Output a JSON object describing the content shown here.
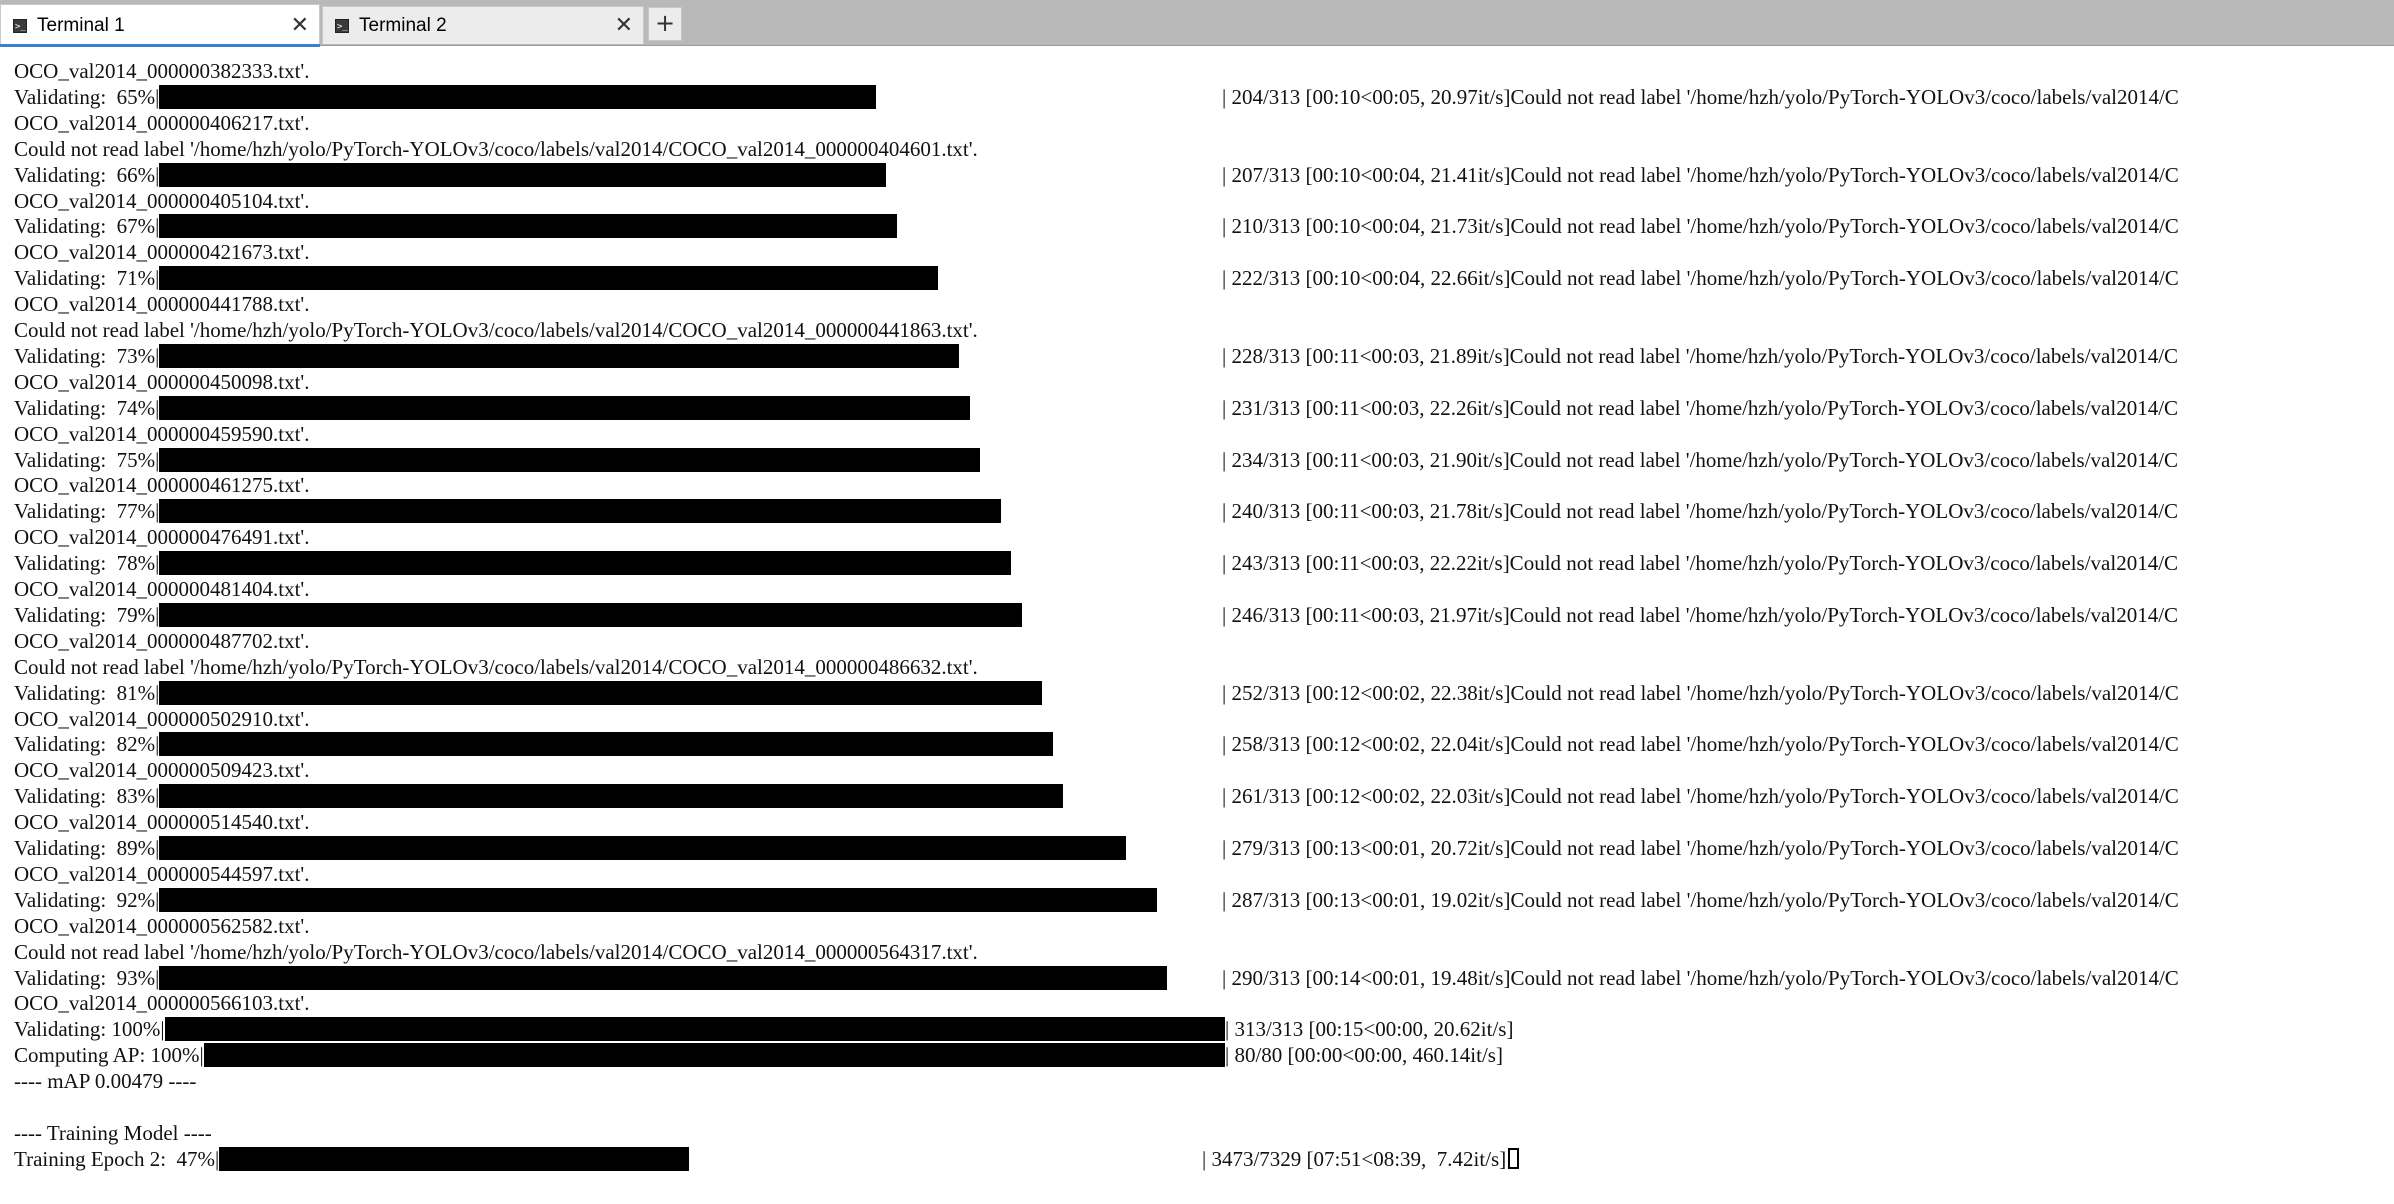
{
  "tabs": [
    {
      "label": "Terminal 1",
      "icon": "terminal-icon",
      "active": true
    },
    {
      "label": "Terminal 2",
      "icon": "terminal-icon",
      "active": false
    }
  ],
  "terminal": {
    "lines": [
      {
        "text": "OCO_val2014_000000382333.txt'."
      },
      {
        "text": "Validating:  65%|",
        "bar": 0.65,
        "stats": "| 204/313 [00:10<00:05, 20.97it/s]Could not read label '/home/hzh/yolo/PyTorch-YOLOv3/coco/labels/val2014/C"
      },
      {
        "text": "OCO_val2014_000000406217.txt'."
      },
      {
        "text": "Could not read label '/home/hzh/yolo/PyTorch-YOLOv3/coco/labels/val2014/COCO_val2014_000000404601.txt'."
      },
      {
        "text": "Validating:  66%|",
        "bar": 0.66,
        "stats": "| 207/313 [00:10<00:04, 21.41it/s]Could not read label '/home/hzh/yolo/PyTorch-YOLOv3/coco/labels/val2014/C"
      },
      {
        "text": "OCO_val2014_000000405104.txt'."
      },
      {
        "text": "Validating:  67%|",
        "bar": 0.67,
        "stats": "| 210/313 [00:10<00:04, 21.73it/s]Could not read label '/home/hzh/yolo/PyTorch-YOLOv3/coco/labels/val2014/C"
      },
      {
        "text": "OCO_val2014_000000421673.txt'."
      },
      {
        "text": "Validating:  71%|",
        "bar": 0.71,
        "stats": "| 222/313 [00:10<00:04, 22.66it/s]Could not read label '/home/hzh/yolo/PyTorch-YOLOv3/coco/labels/val2014/C"
      },
      {
        "text": "OCO_val2014_000000441788.txt'."
      },
      {
        "text": "Could not read label '/home/hzh/yolo/PyTorch-YOLOv3/coco/labels/val2014/COCO_val2014_000000441863.txt'."
      },
      {
        "text": "Validating:  73%|",
        "bar": 0.73,
        "stats": "| 228/313 [00:11<00:03, 21.89it/s]Could not read label '/home/hzh/yolo/PyTorch-YOLOv3/coco/labels/val2014/C"
      },
      {
        "text": "OCO_val2014_000000450098.txt'."
      },
      {
        "text": "Validating:  74%|",
        "bar": 0.74,
        "stats": "| 231/313 [00:11<00:03, 22.26it/s]Could not read label '/home/hzh/yolo/PyTorch-YOLOv3/coco/labels/val2014/C"
      },
      {
        "text": "OCO_val2014_000000459590.txt'."
      },
      {
        "text": "Validating:  75%|",
        "bar": 0.75,
        "stats": "| 234/313 [00:11<00:03, 21.90it/s]Could not read label '/home/hzh/yolo/PyTorch-YOLOv3/coco/labels/val2014/C"
      },
      {
        "text": "OCO_val2014_000000461275.txt'."
      },
      {
        "text": "Validating:  77%|",
        "bar": 0.77,
        "stats": "| 240/313 [00:11<00:03, 21.78it/s]Could not read label '/home/hzh/yolo/PyTorch-YOLOv3/coco/labels/val2014/C"
      },
      {
        "text": "OCO_val2014_000000476491.txt'."
      },
      {
        "text": "Validating:  78%|",
        "bar": 0.78,
        "stats": "| 243/313 [00:11<00:03, 22.22it/s]Could not read label '/home/hzh/yolo/PyTorch-YOLOv3/coco/labels/val2014/C"
      },
      {
        "text": "OCO_val2014_000000481404.txt'."
      },
      {
        "text": "Validating:  79%|",
        "bar": 0.79,
        "stats": "| 246/313 [00:11<00:03, 21.97it/s]Could not read label '/home/hzh/yolo/PyTorch-YOLOv3/coco/labels/val2014/C"
      },
      {
        "text": "OCO_val2014_000000487702.txt'."
      },
      {
        "text": "Could not read label '/home/hzh/yolo/PyTorch-YOLOv3/coco/labels/val2014/COCO_val2014_000000486632.txt'."
      },
      {
        "text": "Validating:  81%|",
        "bar": 0.81,
        "stats": "| 252/313 [00:12<00:02, 22.38it/s]Could not read label '/home/hzh/yolo/PyTorch-YOLOv3/coco/labels/val2014/C"
      },
      {
        "text": "OCO_val2014_000000502910.txt'."
      },
      {
        "text": "Validating:  82%|",
        "bar": 0.82,
        "stats": "| 258/313 [00:12<00:02, 22.04it/s]Could not read label '/home/hzh/yolo/PyTorch-YOLOv3/coco/labels/val2014/C"
      },
      {
        "text": "OCO_val2014_000000509423.txt'."
      },
      {
        "text": "Validating:  83%|",
        "bar": 0.83,
        "stats": "| 261/313 [00:12<00:02, 22.03it/s]Could not read label '/home/hzh/yolo/PyTorch-YOLOv3/coco/labels/val2014/C"
      },
      {
        "text": "OCO_val2014_000000514540.txt'."
      },
      {
        "text": "Validating:  89%|",
        "bar": 0.89,
        "stats": "| 279/313 [00:13<00:01, 20.72it/s]Could not read label '/home/hzh/yolo/PyTorch-YOLOv3/coco/labels/val2014/C"
      },
      {
        "text": "OCO_val2014_000000544597.txt'."
      },
      {
        "text": "Validating:  92%|",
        "bar": 0.92,
        "stats": "| 287/313 [00:13<00:01, 19.02it/s]Could not read label '/home/hzh/yolo/PyTorch-YOLOv3/coco/labels/val2014/C"
      },
      {
        "text": "OCO_val2014_000000562582.txt'."
      },
      {
        "text": "Could not read label '/home/hzh/yolo/PyTorch-YOLOv3/coco/labels/val2014/COCO_val2014_000000564317.txt'."
      },
      {
        "text": "Validating:  93%|",
        "bar": 0.93,
        "stats": "| 290/313 [00:14<00:01, 19.48it/s]Could not read label '/home/hzh/yolo/PyTorch-YOLOv3/coco/labels/val2014/C"
      },
      {
        "text": "OCO_val2014_000000566103.txt'."
      },
      {
        "text": "Validating: 100%|",
        "bar": 1.0,
        "stats": "| 313/313 [00:15<00:00, 20.62it/s]"
      },
      {
        "text": "Computing AP: 100%|",
        "bar": 1.0,
        "stats": "| 80/80 [00:00<00:00, 460.14it/s]"
      },
      {
        "text": "---- mAP 0.00479 ----"
      },
      {
        "text": ""
      },
      {
        "text": "---- Training Model ----"
      },
      {
        "text": "Training Epoch 2:  47%|",
        "bar": 0.47,
        "stats": "| 3473/7329 [07:51<08:39,  7.42it/s]",
        "cursor": true
      }
    ]
  }
}
